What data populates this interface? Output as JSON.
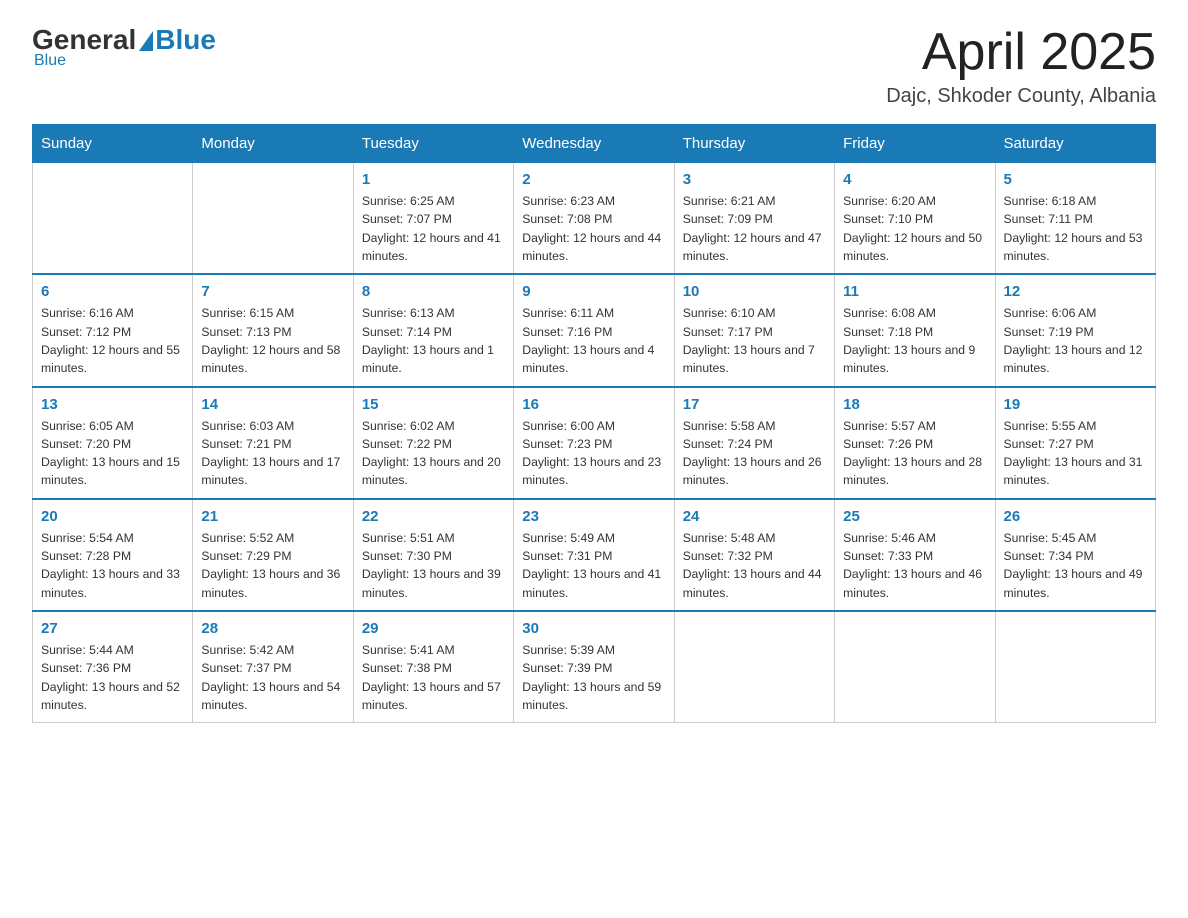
{
  "header": {
    "logo_general": "General",
    "logo_blue": "Blue",
    "logo_underline": "Blue",
    "title": "April 2025",
    "subtitle": "Dajc, Shkoder County, Albania"
  },
  "weekdays": [
    "Sunday",
    "Monday",
    "Tuesday",
    "Wednesday",
    "Thursday",
    "Friday",
    "Saturday"
  ],
  "weeks": [
    [
      {
        "day": "",
        "sunrise": "",
        "sunset": "",
        "daylight": ""
      },
      {
        "day": "",
        "sunrise": "",
        "sunset": "",
        "daylight": ""
      },
      {
        "day": "1",
        "sunrise": "6:25 AM",
        "sunset": "7:07 PM",
        "daylight": "12 hours and 41 minutes."
      },
      {
        "day": "2",
        "sunrise": "6:23 AM",
        "sunset": "7:08 PM",
        "daylight": "12 hours and 44 minutes."
      },
      {
        "day": "3",
        "sunrise": "6:21 AM",
        "sunset": "7:09 PM",
        "daylight": "12 hours and 47 minutes."
      },
      {
        "day": "4",
        "sunrise": "6:20 AM",
        "sunset": "7:10 PM",
        "daylight": "12 hours and 50 minutes."
      },
      {
        "day": "5",
        "sunrise": "6:18 AM",
        "sunset": "7:11 PM",
        "daylight": "12 hours and 53 minutes."
      }
    ],
    [
      {
        "day": "6",
        "sunrise": "6:16 AM",
        "sunset": "7:12 PM",
        "daylight": "12 hours and 55 minutes."
      },
      {
        "day": "7",
        "sunrise": "6:15 AM",
        "sunset": "7:13 PM",
        "daylight": "12 hours and 58 minutes."
      },
      {
        "day": "8",
        "sunrise": "6:13 AM",
        "sunset": "7:14 PM",
        "daylight": "13 hours and 1 minute."
      },
      {
        "day": "9",
        "sunrise": "6:11 AM",
        "sunset": "7:16 PM",
        "daylight": "13 hours and 4 minutes."
      },
      {
        "day": "10",
        "sunrise": "6:10 AM",
        "sunset": "7:17 PM",
        "daylight": "13 hours and 7 minutes."
      },
      {
        "day": "11",
        "sunrise": "6:08 AM",
        "sunset": "7:18 PM",
        "daylight": "13 hours and 9 minutes."
      },
      {
        "day": "12",
        "sunrise": "6:06 AM",
        "sunset": "7:19 PM",
        "daylight": "13 hours and 12 minutes."
      }
    ],
    [
      {
        "day": "13",
        "sunrise": "6:05 AM",
        "sunset": "7:20 PM",
        "daylight": "13 hours and 15 minutes."
      },
      {
        "day": "14",
        "sunrise": "6:03 AM",
        "sunset": "7:21 PM",
        "daylight": "13 hours and 17 minutes."
      },
      {
        "day": "15",
        "sunrise": "6:02 AM",
        "sunset": "7:22 PM",
        "daylight": "13 hours and 20 minutes."
      },
      {
        "day": "16",
        "sunrise": "6:00 AM",
        "sunset": "7:23 PM",
        "daylight": "13 hours and 23 minutes."
      },
      {
        "day": "17",
        "sunrise": "5:58 AM",
        "sunset": "7:24 PM",
        "daylight": "13 hours and 26 minutes."
      },
      {
        "day": "18",
        "sunrise": "5:57 AM",
        "sunset": "7:26 PM",
        "daylight": "13 hours and 28 minutes."
      },
      {
        "day": "19",
        "sunrise": "5:55 AM",
        "sunset": "7:27 PM",
        "daylight": "13 hours and 31 minutes."
      }
    ],
    [
      {
        "day": "20",
        "sunrise": "5:54 AM",
        "sunset": "7:28 PM",
        "daylight": "13 hours and 33 minutes."
      },
      {
        "day": "21",
        "sunrise": "5:52 AM",
        "sunset": "7:29 PM",
        "daylight": "13 hours and 36 minutes."
      },
      {
        "day": "22",
        "sunrise": "5:51 AM",
        "sunset": "7:30 PM",
        "daylight": "13 hours and 39 minutes."
      },
      {
        "day": "23",
        "sunrise": "5:49 AM",
        "sunset": "7:31 PM",
        "daylight": "13 hours and 41 minutes."
      },
      {
        "day": "24",
        "sunrise": "5:48 AM",
        "sunset": "7:32 PM",
        "daylight": "13 hours and 44 minutes."
      },
      {
        "day": "25",
        "sunrise": "5:46 AM",
        "sunset": "7:33 PM",
        "daylight": "13 hours and 46 minutes."
      },
      {
        "day": "26",
        "sunrise": "5:45 AM",
        "sunset": "7:34 PM",
        "daylight": "13 hours and 49 minutes."
      }
    ],
    [
      {
        "day": "27",
        "sunrise": "5:44 AM",
        "sunset": "7:36 PM",
        "daylight": "13 hours and 52 minutes."
      },
      {
        "day": "28",
        "sunrise": "5:42 AM",
        "sunset": "7:37 PM",
        "daylight": "13 hours and 54 minutes."
      },
      {
        "day": "29",
        "sunrise": "5:41 AM",
        "sunset": "7:38 PM",
        "daylight": "13 hours and 57 minutes."
      },
      {
        "day": "30",
        "sunrise": "5:39 AM",
        "sunset": "7:39 PM",
        "daylight": "13 hours and 59 minutes."
      },
      {
        "day": "",
        "sunrise": "",
        "sunset": "",
        "daylight": ""
      },
      {
        "day": "",
        "sunrise": "",
        "sunset": "",
        "daylight": ""
      },
      {
        "day": "",
        "sunrise": "",
        "sunset": "",
        "daylight": ""
      }
    ]
  ]
}
